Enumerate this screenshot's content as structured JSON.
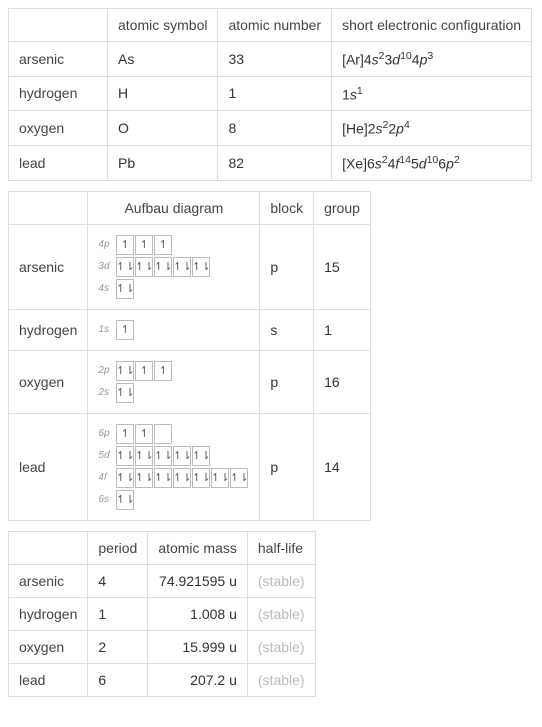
{
  "table1": {
    "headers": [
      "atomic symbol",
      "atomic number",
      "short electronic configuration"
    ],
    "rows": [
      {
        "name": "arsenic",
        "symbol": "As",
        "number": "33",
        "config_html": "[Ar]4<i>s</i><sup>2</sup>3<i>d</i><sup>10</sup>4<i>p</i><sup>3</sup>"
      },
      {
        "name": "hydrogen",
        "symbol": "H",
        "number": "1",
        "config_html": "1<i>s</i><sup>1</sup>"
      },
      {
        "name": "oxygen",
        "symbol": "O",
        "number": "8",
        "config_html": "[He]2<i>s</i><sup>2</sup>2<i>p</i><sup>4</sup>"
      },
      {
        "name": "lead",
        "symbol": "Pb",
        "number": "82",
        "config_html": "[Xe]6<i>s</i><sup>2</sup>4<i>f</i><sup>14</sup>5<i>d</i><sup>10</sup>6<i>p</i><sup>2</sup>"
      }
    ]
  },
  "table2": {
    "headers": [
      "Aufbau diagram",
      "block",
      "group"
    ],
    "rows": [
      {
        "name": "arsenic",
        "block": "p",
        "group": "15",
        "aufbau": [
          {
            "label": "4p",
            "boxes": [
              "u",
              "u",
              "u"
            ]
          },
          {
            "label": "3d",
            "boxes": [
              "ud",
              "ud",
              "ud",
              "ud",
              "ud"
            ]
          },
          {
            "label": "4s",
            "boxes": [
              "ud"
            ]
          }
        ]
      },
      {
        "name": "hydrogen",
        "block": "s",
        "group": "1",
        "aufbau": [
          {
            "label": "1s",
            "boxes": [
              "u"
            ]
          }
        ]
      },
      {
        "name": "oxygen",
        "block": "p",
        "group": "16",
        "aufbau": [
          {
            "label": "2p",
            "boxes": [
              "ud",
              "u",
              "u"
            ]
          },
          {
            "label": "2s",
            "boxes": [
              "ud"
            ]
          }
        ]
      },
      {
        "name": "lead",
        "block": "p",
        "group": "14",
        "aufbau": [
          {
            "label": "6p",
            "boxes": [
              "u",
              "u",
              ""
            ]
          },
          {
            "label": "5d",
            "boxes": [
              "ud",
              "ud",
              "ud",
              "ud",
              "ud"
            ]
          },
          {
            "label": "4f",
            "boxes": [
              "ud",
              "ud",
              "ud",
              "ud",
              "ud",
              "ud",
              "ud"
            ]
          },
          {
            "label": "6s",
            "boxes": [
              "ud"
            ]
          }
        ]
      }
    ]
  },
  "table3": {
    "headers": [
      "period",
      "atomic mass",
      "half-life"
    ],
    "rows": [
      {
        "name": "arsenic",
        "period": "4",
        "mass": "74.921595 u",
        "half": "(stable)"
      },
      {
        "name": "hydrogen",
        "period": "1",
        "mass": "1.008 u",
        "half": "(stable)"
      },
      {
        "name": "oxygen",
        "period": "2",
        "mass": "15.999 u",
        "half": "(stable)"
      },
      {
        "name": "lead",
        "period": "6",
        "mass": "207.2 u",
        "half": "(stable)"
      }
    ]
  },
  "chart_data": {
    "type": "table",
    "elements": [
      {
        "name": "arsenic",
        "symbol": "As",
        "atomic_number": 33,
        "short_config": "[Ar]4s2 3d10 4p3",
        "block": "p",
        "group": 15,
        "period": 4,
        "atomic_mass_u": 74.921595,
        "half_life": "stable",
        "aufbau": {
          "4p": [
            1,
            1,
            1
          ],
          "3d": [
            2,
            2,
            2,
            2,
            2
          ],
          "4s": [
            2
          ]
        }
      },
      {
        "name": "hydrogen",
        "symbol": "H",
        "atomic_number": 1,
        "short_config": "1s1",
        "block": "s",
        "group": 1,
        "period": 1,
        "atomic_mass_u": 1.008,
        "half_life": "stable",
        "aufbau": {
          "1s": [
            1
          ]
        }
      },
      {
        "name": "oxygen",
        "symbol": "O",
        "atomic_number": 8,
        "short_config": "[He]2s2 2p4",
        "block": "p",
        "group": 16,
        "period": 2,
        "atomic_mass_u": 15.999,
        "half_life": "stable",
        "aufbau": {
          "2p": [
            2,
            1,
            1
          ],
          "2s": [
            2
          ]
        }
      },
      {
        "name": "lead",
        "symbol": "Pb",
        "atomic_number": 82,
        "short_config": "[Xe]6s2 4f14 5d10 6p2",
        "block": "p",
        "group": 14,
        "period": 6,
        "atomic_mass_u": 207.2,
        "half_life": "stable",
        "aufbau": {
          "6p": [
            1,
            1,
            0
          ],
          "5d": [
            2,
            2,
            2,
            2,
            2
          ],
          "4f": [
            2,
            2,
            2,
            2,
            2,
            2,
            2
          ],
          "6s": [
            2
          ]
        }
      }
    ]
  }
}
